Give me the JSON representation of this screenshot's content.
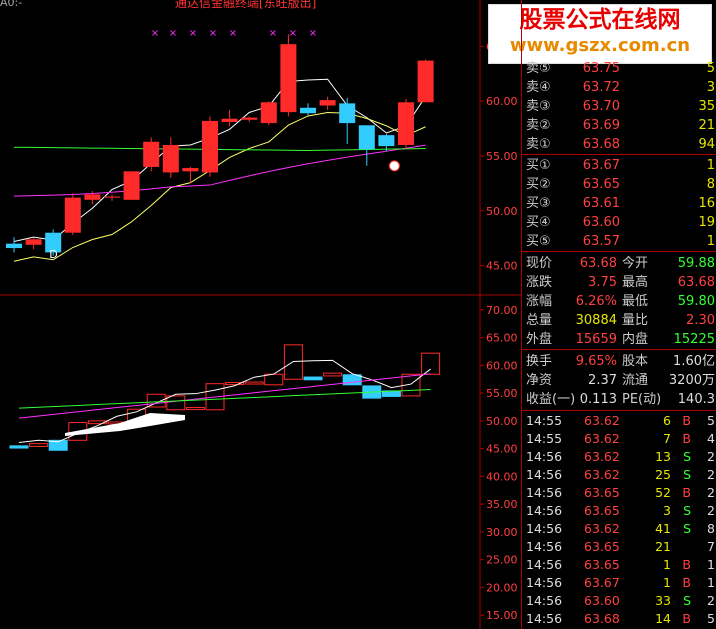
{
  "header": {
    "indicator_label": "A0:-",
    "formula_title": "通达信金融终端[东旺版出]"
  },
  "watermark": {
    "title": "股票公式在线网",
    "url": "www.gszx.com.cn"
  },
  "kline": {
    "marker_label": "D",
    "y_axis_ticks": [
      "65.00",
      "60.00",
      "55.00",
      "50.00",
      "45.00"
    ],
    "price_range": [
      42.5,
      68.5
    ],
    "candles": [
      {
        "o": 47.0,
        "h": 47.6,
        "l": 46.2,
        "c": 46.6
      },
      {
        "o": 46.9,
        "h": 47.5,
        "l": 46.5,
        "c": 47.4
      },
      {
        "o": 48.0,
        "h": 48.3,
        "l": 45.9,
        "c": 46.2
      },
      {
        "o": 48.0,
        "h": 51.6,
        "l": 47.8,
        "c": 51.2
      },
      {
        "o": 51.0,
        "h": 51.8,
        "l": 50.6,
        "c": 51.5
      },
      {
        "o": 51.2,
        "h": 51.5,
        "l": 50.9,
        "c": 51.3
      },
      {
        "o": 51.0,
        "h": 53.6,
        "l": 51.0,
        "c": 53.6
      },
      {
        "o": 54.0,
        "h": 56.7,
        "l": 53.6,
        "c": 56.3
      },
      {
        "o": 53.5,
        "h": 56.7,
        "l": 53.0,
        "c": 56.0
      },
      {
        "o": 53.6,
        "h": 54.0,
        "l": 52.5,
        "c": 53.9
      },
      {
        "o": 53.5,
        "h": 58.6,
        "l": 53.1,
        "c": 58.2
      },
      {
        "o": 58.1,
        "h": 59.2,
        "l": 57.7,
        "c": 58.4
      },
      {
        "o": 58.3,
        "h": 58.6,
        "l": 58.1,
        "c": 58.5
      },
      {
        "o": 58.0,
        "h": 60.0,
        "l": 57.8,
        "c": 59.9
      },
      {
        "o": 59.0,
        "h": 66.1,
        "l": 58.6,
        "c": 65.2
      },
      {
        "o": 59.4,
        "h": 59.8,
        "l": 58.7,
        "c": 58.9
      },
      {
        "o": 59.6,
        "h": 60.4,
        "l": 59.2,
        "c": 60.1
      },
      {
        "o": 59.8,
        "h": 60.3,
        "l": 56.1,
        "c": 58.0
      },
      {
        "o": 57.8,
        "h": 57.8,
        "l": 54.1,
        "c": 55.6
      },
      {
        "o": 56.9,
        "h": 57.0,
        "l": 55.4,
        "c": 55.9
      },
      {
        "o": 56.0,
        "h": 60.2,
        "l": 55.6,
        "c": 59.9
      },
      {
        "o": 59.9,
        "h": 63.8,
        "l": 59.9,
        "c": 63.7
      }
    ]
  },
  "formula": {
    "y_axis_ticks": [
      "70.00",
      "65.00",
      "60.00",
      "55.00",
      "50.00",
      "45.00",
      "40.00",
      "35.00",
      "30.00",
      "25.00",
      "20.00",
      "15.00"
    ],
    "range": [
      12.5,
      72.5
    ]
  },
  "quote": {
    "asks": [
      {
        "label": "卖⑤",
        "price": "63.75",
        "vol": "5"
      },
      {
        "label": "卖④",
        "price": "63.72",
        "vol": "3"
      },
      {
        "label": "卖③",
        "price": "63.70",
        "vol": "35"
      },
      {
        "label": "卖②",
        "price": "63.69",
        "vol": "21"
      },
      {
        "label": "卖①",
        "price": "63.68",
        "vol": "94"
      }
    ],
    "bids": [
      {
        "label": "买①",
        "price": "63.67",
        "vol": "1"
      },
      {
        "label": "买②",
        "price": "63.65",
        "vol": "8"
      },
      {
        "label": "买③",
        "price": "63.61",
        "vol": "16"
      },
      {
        "label": "买④",
        "price": "63.60",
        "vol": "19"
      },
      {
        "label": "买⑤",
        "price": "63.57",
        "vol": "1"
      }
    ],
    "stats": [
      {
        "l1": "现价",
        "v1": "63.68",
        "l2": "今开",
        "v2": "59.88"
      },
      {
        "l1": "涨跌",
        "v1": "3.75",
        "l2": "最高",
        "v2": "63.68"
      },
      {
        "l1": "涨幅",
        "v1": "6.26%",
        "l2": "最低",
        "v2": "59.80"
      },
      {
        "l1": "总量",
        "v1": "30884",
        "l2": "量比",
        "v2": "2.30"
      },
      {
        "l1": "外盘",
        "v1": "15659",
        "l2": "内盘",
        "v2": "15225"
      }
    ],
    "finance": [
      {
        "l1": "换手",
        "v1": "9.65%",
        "l2": "股本",
        "v2": "1.60亿"
      },
      {
        "l1": "净资",
        "v1": "2.37",
        "l2": "流通",
        "v2": "3200万"
      },
      {
        "l1": "收益(一)",
        "v1": "0.113",
        "l2": "PE(动)",
        "v2": "140.3"
      }
    ],
    "ticks": [
      {
        "time": "14:55",
        "price": "63.62",
        "vol": "6",
        "side": "B",
        "n": "5"
      },
      {
        "time": "14:55",
        "price": "63.62",
        "vol": "7",
        "side": "B",
        "n": "4"
      },
      {
        "time": "14:56",
        "price": "63.62",
        "vol": "13",
        "side": "S",
        "n": "2"
      },
      {
        "time": "14:56",
        "price": "63.62",
        "vol": "25",
        "side": "S",
        "n": "2"
      },
      {
        "time": "14:56",
        "price": "63.65",
        "vol": "52",
        "side": "B",
        "n": "2"
      },
      {
        "time": "14:56",
        "price": "63.65",
        "vol": "3",
        "side": "S",
        "n": "2"
      },
      {
        "time": "14:56",
        "price": "63.62",
        "vol": "41",
        "side": "S",
        "n": "8"
      },
      {
        "time": "14:56",
        "price": "63.65",
        "vol": "21",
        "side": "",
        "n": "7"
      },
      {
        "time": "14:56",
        "price": "63.65",
        "vol": "1",
        "side": "B",
        "n": "1"
      },
      {
        "time": "14:56",
        "price": "63.67",
        "vol": "1",
        "side": "B",
        "n": "1"
      },
      {
        "time": "14:56",
        "price": "63.60",
        "vol": "33",
        "side": "S",
        "n": "2"
      },
      {
        "time": "14:56",
        "price": "63.68",
        "vol": "14",
        "side": "B",
        "n": "5"
      }
    ]
  },
  "colors": {
    "up": "#ff2a2a",
    "down": "#33ccff",
    "ma5": "#ffffff",
    "ma10": "#ffff66",
    "ma20": "#ff33ff",
    "ma60": "#33ff33",
    "grid": "#aa0000",
    "buy": "#ff4040",
    "sell": "#33ff33"
  }
}
